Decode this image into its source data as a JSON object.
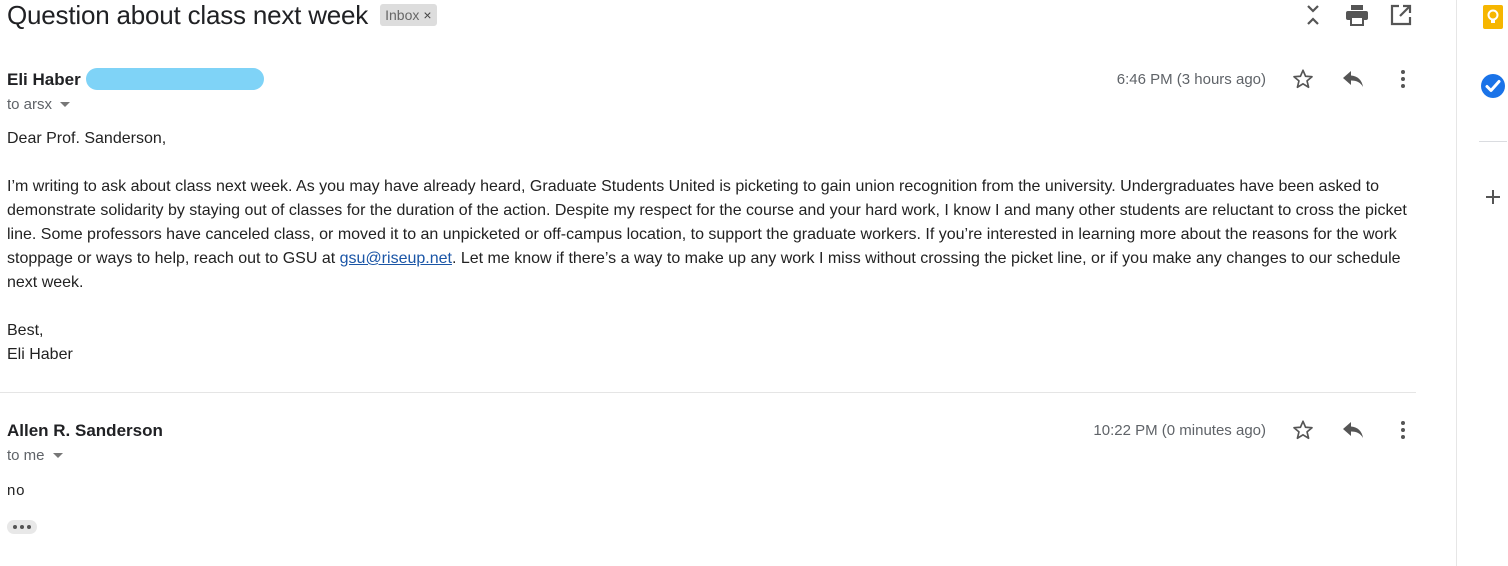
{
  "thread": {
    "subject": "Question about class next week",
    "label": "Inbox",
    "label_remove": "×",
    "top_icons": [
      "collapse-icon",
      "print-icon",
      "open-new-window-icon"
    ]
  },
  "messages": [
    {
      "sender": "Eli Haber",
      "recipient": "to arsx",
      "timestamp": "6:46 PM (3 hours ago)",
      "body": {
        "greeting": "Dear Prof. Sanderson,",
        "paragraph_before_link": "I’m writing to ask about class next week. As you may have already heard, Graduate Students United is picketing to gain union recognition from the university. Undergraduates have been asked to demonstrate solidarity by staying out of classes for the duration of the action. Despite my respect for the course and your hard work, I know I and many other students are reluctant to cross the picket line. Some professors have canceled class, or moved it to an unpicketed or off-campus location, to support the graduate workers. If you’re interested in learning more about the reasons for the work stoppage or ways to help, reach out to GSU at ",
        "link": "gsu@riseup.net",
        "paragraph_after_link": ". Let me know if there’s a way to make up any work I miss without crossing the picket line, or if you make any changes to our schedule next week.",
        "closing": "Best,",
        "signature": "Eli Haber"
      }
    },
    {
      "sender": "Allen R. Sanderson",
      "recipient": "to me",
      "timestamp": "10:22 PM (0 minutes ago)",
      "body": {
        "text": "no"
      }
    }
  ],
  "message_actions": [
    "star-icon",
    "reply-icon",
    "more-vert-icon"
  ],
  "side_panel": [
    "keep-icon",
    "tasks-icon",
    "add-icon"
  ],
  "colors": {
    "keep": "#f6b600",
    "tasks": "#1a73e8",
    "link": "#1a55a6",
    "redaction": "#7fd3f7"
  }
}
